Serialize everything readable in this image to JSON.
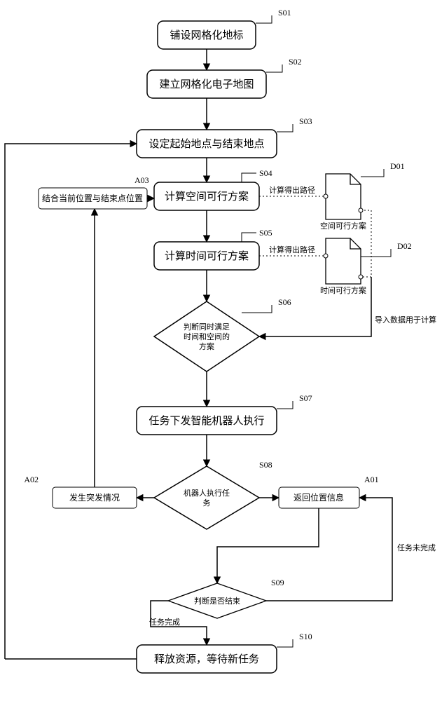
{
  "steps": {
    "s01": {
      "id": "S01",
      "label": "铺设网格化地标"
    },
    "s02": {
      "id": "S02",
      "label": "建立网格化电子地图"
    },
    "s03": {
      "id": "S03",
      "label": "设定起始地点与结束地点"
    },
    "s04": {
      "id": "S04",
      "label": "计算空间可行方案"
    },
    "s05": {
      "id": "S05",
      "label": "计算时间可行方案"
    },
    "s06": {
      "id": "S06",
      "label_l1": "判断同时满足",
      "label_l2": "时间和空间的",
      "label_l3": "方案"
    },
    "s07": {
      "id": "S07",
      "label": "任务下发智能机器人执行"
    },
    "s08": {
      "id": "S08",
      "label_l1": "机器人执行任",
      "label_l2": "务"
    },
    "s09": {
      "id": "S09",
      "label": "判断是否结束"
    },
    "s10": {
      "id": "S10",
      "label": "释放资源，等待新任务"
    }
  },
  "aux": {
    "a01": {
      "id": "A01",
      "label": "返回位置信息"
    },
    "a02": {
      "id": "A02",
      "label": "发生突发情况"
    },
    "a03": {
      "id": "A03",
      "label": "结合当前位置与结束点位置"
    }
  },
  "docs": {
    "d01": {
      "id": "D01",
      "label": "空间可行方案"
    },
    "d02": {
      "id": "D02",
      "label": "时间可行方案"
    }
  },
  "edges": {
    "calc_path": "计算得出路径",
    "import_data": "导入数据用于计算",
    "task_done": "任务完成",
    "task_not_done": "任务未完成"
  }
}
